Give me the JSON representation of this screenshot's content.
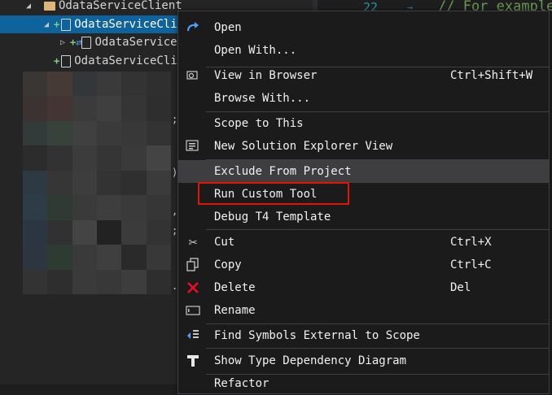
{
  "tree": {
    "items": [
      {
        "label": "OdataServiceClient"
      },
      {
        "label": "OdataServiceCli"
      },
      {
        "label": "OdataService"
      },
      {
        "label": "OdataServiceCli"
      }
    ]
  },
  "editor": {
    "line_number": "22",
    "comment": "// For example"
  },
  "menu": {
    "items": [
      {
        "label": "Open",
        "icon": "redo-arrow-icon",
        "shortcut": ""
      },
      {
        "label": "Open With...",
        "icon": "",
        "shortcut": ""
      },
      {
        "label": "View in Browser",
        "icon": "browser-icon",
        "shortcut": "Ctrl+Shift+W"
      },
      {
        "label": "Browse With...",
        "icon": "",
        "shortcut": ""
      },
      {
        "label": "Scope to This",
        "icon": "",
        "shortcut": ""
      },
      {
        "label": "New Solution Explorer View",
        "icon": "solution-explorer-icon",
        "shortcut": ""
      },
      {
        "label": "Exclude From Project",
        "icon": "",
        "shortcut": ""
      },
      {
        "label": "Run Custom Tool",
        "icon": "",
        "shortcut": ""
      },
      {
        "label": "Debug T4 Template",
        "icon": "",
        "shortcut": ""
      },
      {
        "label": "Cut",
        "icon": "scissors-icon",
        "shortcut": "Ctrl+X"
      },
      {
        "label": "Copy",
        "icon": "copy-icon",
        "shortcut": "Ctrl+C"
      },
      {
        "label": "Delete",
        "icon": "delete-x-icon",
        "shortcut": "Del"
      },
      {
        "label": "Rename",
        "icon": "rename-icon",
        "shortcut": ""
      },
      {
        "label": "Find Symbols External to Scope",
        "icon": "find-symbols-icon",
        "shortcut": ""
      },
      {
        "label": "Show Type Dependency Diagram",
        "icon": "type-dependency-icon",
        "shortcut": ""
      },
      {
        "label": "Refactor",
        "icon": "",
        "shortcut": ""
      }
    ]
  },
  "colors": {
    "selection": "#0e639c",
    "highlight": "#e51400",
    "delete": "#e81123"
  }
}
